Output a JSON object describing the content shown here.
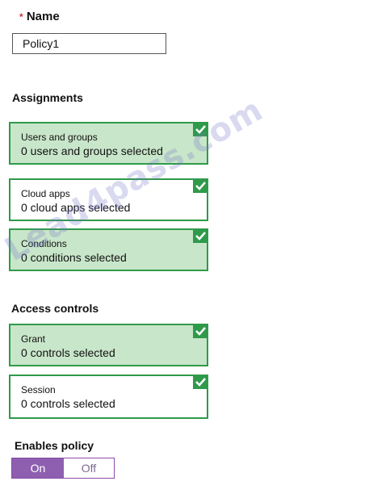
{
  "name_field": {
    "required_marker": "*",
    "label": "Name",
    "value": "Policy1"
  },
  "assignments": {
    "title": "Assignments",
    "items": [
      {
        "title": "Users and groups",
        "value": "0 users and groups selected",
        "selected": true,
        "checked": true
      },
      {
        "title": "Cloud apps",
        "value": "0 cloud apps selected",
        "selected": false,
        "checked": true
      },
      {
        "title": "Conditions",
        "value": "0 conditions selected",
        "selected": true,
        "checked": true
      }
    ]
  },
  "access_controls": {
    "title": "Access controls",
    "items": [
      {
        "title": "Grant",
        "value": "0 controls selected",
        "selected": true,
        "checked": true
      },
      {
        "title": "Session",
        "value": "0 controls selected",
        "selected": false,
        "checked": true
      }
    ]
  },
  "enable_policy": {
    "label": "Enables policy",
    "on_label": "On",
    "off_label": "Off",
    "state": "On"
  },
  "watermark": "Lead4pass.com",
  "colors": {
    "card_selected_bg": "#c8e6c9",
    "card_border": "#2f9a4a",
    "checkmark_bg": "#2f9a4a",
    "toggle_on_bg": "#8e5fb0",
    "required_star": "#d13438"
  },
  "icons": [
    "checkmark-icon"
  ]
}
